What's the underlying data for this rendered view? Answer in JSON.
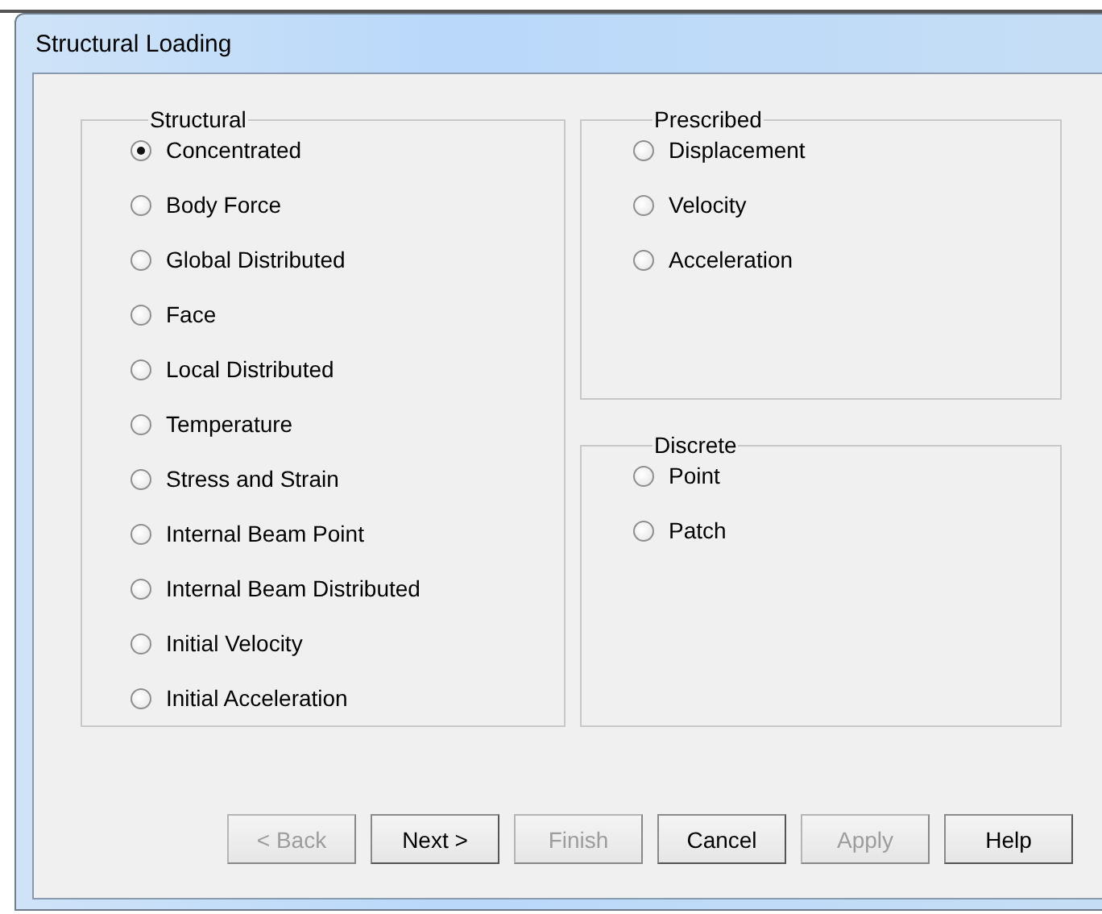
{
  "window": {
    "title": "Structural Loading"
  },
  "groups": [
    {
      "title": "Structural",
      "options": [
        {
          "label": "Concentrated",
          "selected": true
        },
        {
          "label": "Body Force",
          "selected": false
        },
        {
          "label": "Global Distributed",
          "selected": false
        },
        {
          "label": "Face",
          "selected": false
        },
        {
          "label": "Local Distributed",
          "selected": false
        },
        {
          "label": "Temperature",
          "selected": false
        },
        {
          "label": "Stress and Strain",
          "selected": false
        },
        {
          "label": "Internal Beam Point",
          "selected": false
        },
        {
          "label": "Internal Beam Distributed",
          "selected": false
        },
        {
          "label": "Initial Velocity",
          "selected": false
        },
        {
          "label": "Initial Acceleration",
          "selected": false
        }
      ]
    },
    {
      "title": "Prescribed",
      "options": [
        {
          "label": "Displacement",
          "selected": false
        },
        {
          "label": "Velocity",
          "selected": false
        },
        {
          "label": "Acceleration",
          "selected": false
        }
      ]
    },
    {
      "title": "Discrete",
      "options": [
        {
          "label": "Point",
          "selected": false
        },
        {
          "label": "Patch",
          "selected": false
        }
      ]
    }
  ],
  "buttons": [
    {
      "label": "< Back",
      "disabled": true
    },
    {
      "label": "Next >",
      "disabled": false
    },
    {
      "label": "Finish",
      "disabled": true
    },
    {
      "label": "Cancel",
      "disabled": false
    },
    {
      "label": "Apply",
      "disabled": true
    },
    {
      "label": "Help",
      "disabled": false
    }
  ]
}
